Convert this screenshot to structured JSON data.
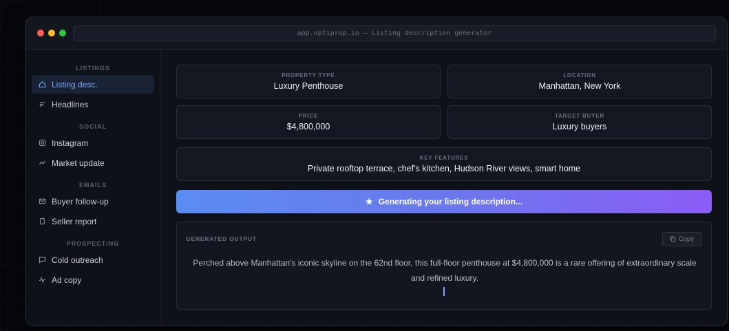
{
  "window": {
    "url": "app.optiprop.io — Listing description generator"
  },
  "sidebar": {
    "sections": [
      {
        "label": "LISTINGS"
      },
      {
        "label": "SOCIAL"
      },
      {
        "label": "EMAILS"
      },
      {
        "label": "PROSPECTING"
      }
    ],
    "items": [
      {
        "label": "Listing desc.",
        "icon": "home-icon",
        "active": true
      },
      {
        "label": "Headlines",
        "icon": "lines-icon"
      },
      {
        "label": "Instagram",
        "icon": "instagram-icon"
      },
      {
        "label": "Market update",
        "icon": "trend-icon"
      },
      {
        "label": "Buyer follow-up",
        "icon": "mail-icon"
      },
      {
        "label": "Seller report",
        "icon": "document-icon"
      },
      {
        "label": "Cold outreach",
        "icon": "chat-icon"
      },
      {
        "label": "Ad copy",
        "icon": "pulse-icon"
      }
    ]
  },
  "form": {
    "property_type": {
      "label": "PROPERTY TYPE",
      "value": "Luxury Penthouse"
    },
    "location": {
      "label": "LOCATION",
      "value": "Manhattan, New York"
    },
    "price": {
      "label": "PRICE",
      "value": "$4,800,000"
    },
    "target_buyer": {
      "label": "TARGET BUYER",
      "value": "Luxury buyers"
    },
    "key_features": {
      "label": "KEY FEATURES",
      "value": "Private rooftop terrace, chef's kitchen, Hudson River views, smart home"
    }
  },
  "generate_button": {
    "icon": "star-icon",
    "label": "Generating your listing description..."
  },
  "output": {
    "label": "GENERATED OUTPUT",
    "copy_label": "Copy",
    "text": "Perched above Manhattan's iconic skyline on the 62nd floor, this full-floor penthouse at $4,800,000 is a rare offering of extraordinary scale and refined luxury."
  },
  "colors": {
    "background": "#07080c",
    "window": "#0f1118",
    "accent": "#7fa8ff",
    "gradient_start": "#5b8cf2",
    "gradient_end": "#8b5cf6"
  }
}
